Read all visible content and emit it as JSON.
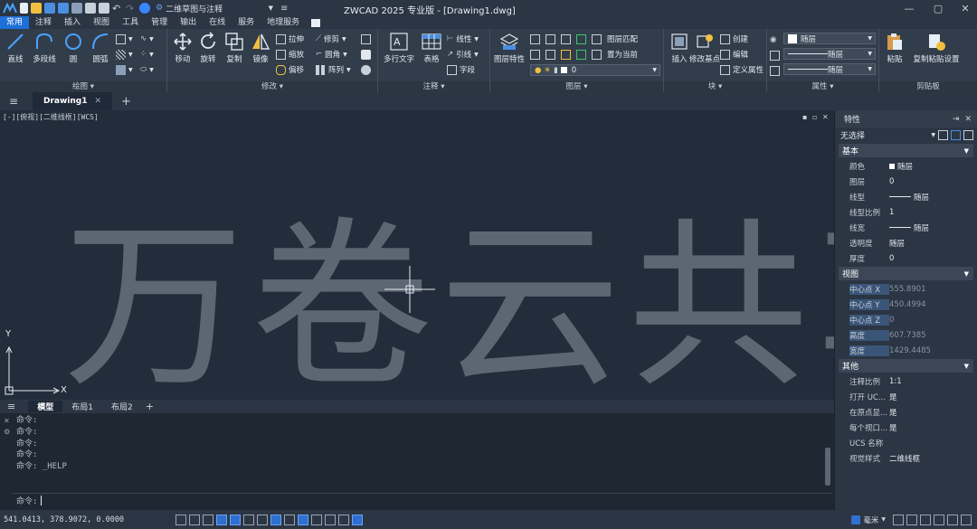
{
  "titlebar": {
    "title": "ZWCAD 2025 专业版 - [Drawing1.dwg]",
    "workspace": "二维草图与注释",
    "logo": "logo-icon"
  },
  "menu": {
    "tabs": [
      "常用",
      "注释",
      "插入",
      "视图",
      "工具",
      "管理",
      "输出",
      "在线",
      "服务",
      "地理服务"
    ],
    "active": "常用"
  },
  "ribbon": {
    "draw": {
      "title": "绘图",
      "big": [
        "直线",
        "多段线",
        "圆",
        "圆弧"
      ]
    },
    "modify": {
      "title": "修改",
      "big": [
        "移动",
        "旋转",
        "复制",
        "镜像"
      ],
      "small": [
        "拉伸",
        "缩放",
        "偏移",
        "修剪",
        "圆角",
        "阵列"
      ]
    },
    "annotation": {
      "title": "注释",
      "big": [
        "多行文字",
        "表格"
      ],
      "small": [
        "线性",
        "引线",
        "字段"
      ]
    },
    "layers": {
      "title": "图层",
      "big": "图层特性",
      "small": [
        "图层匹配",
        "置为当前"
      ],
      "current_layer": "0"
    },
    "block": {
      "title": "块",
      "big": [
        "插入",
        "修改基点"
      ],
      "small": [
        "创建",
        "编辑",
        "定义属性"
      ]
    },
    "properties": {
      "title": "属性",
      "color": "随层",
      "linetype": "随层",
      "lineweight": "随层"
    },
    "clipboard": {
      "title": "剪贴板",
      "big": [
        "粘贴",
        "复制粘贴设置"
      ]
    }
  },
  "doc_tab": {
    "name": "Drawing1"
  },
  "drawing": {
    "view_label": "[-][俯视][二维线框][WCS]",
    "watermark": "万卷云共享",
    "axis_x": "X",
    "axis_y": "Y"
  },
  "layout_tabs": [
    "模型",
    "布局1",
    "布局2"
  ],
  "command": {
    "lines": [
      "命令:",
      "命令:",
      "命令:",
      "命令:",
      "命令: _HELP"
    ],
    "prompt": "命令:"
  },
  "status": {
    "coords": "541.0413, 378.9072, 0.0000",
    "unit": "毫米"
  },
  "properties_panel": {
    "title": "特性",
    "selection": "无选择",
    "sections": {
      "basic": "基本",
      "view": "视图",
      "misc": "其他"
    },
    "basic_rows": [
      {
        "k": "颜色",
        "v": "随层"
      },
      {
        "k": "图层",
        "v": "0"
      },
      {
        "k": "线型",
        "v": "随层"
      },
      {
        "k": "线型比例",
        "v": "1"
      },
      {
        "k": "线宽",
        "v": "随层"
      },
      {
        "k": "透明度",
        "v": "随层"
      },
      {
        "k": "厚度",
        "v": "0"
      }
    ],
    "view_rows": [
      {
        "k": "中心点 X",
        "v": "555.8901"
      },
      {
        "k": "中心点 Y",
        "v": "450.4994"
      },
      {
        "k": "中心点 Z",
        "v": "0"
      },
      {
        "k": "高度",
        "v": "607.7385"
      },
      {
        "k": "宽度",
        "v": "1429.4485"
      }
    ],
    "misc_rows": [
      {
        "k": "注释比例",
        "v": "1:1"
      },
      {
        "k": "打开 UC...",
        "v": "是"
      },
      {
        "k": "在原点显...",
        "v": "是"
      },
      {
        "k": "每个视口...",
        "v": "是"
      },
      {
        "k": "UCS 名称",
        "v": ""
      },
      {
        "k": "视觉样式",
        "v": "二维线框"
      }
    ]
  },
  "colors": {
    "accent": "#1e6fd9",
    "canvas": "#222c3a",
    "watermark": "#5d6673"
  }
}
